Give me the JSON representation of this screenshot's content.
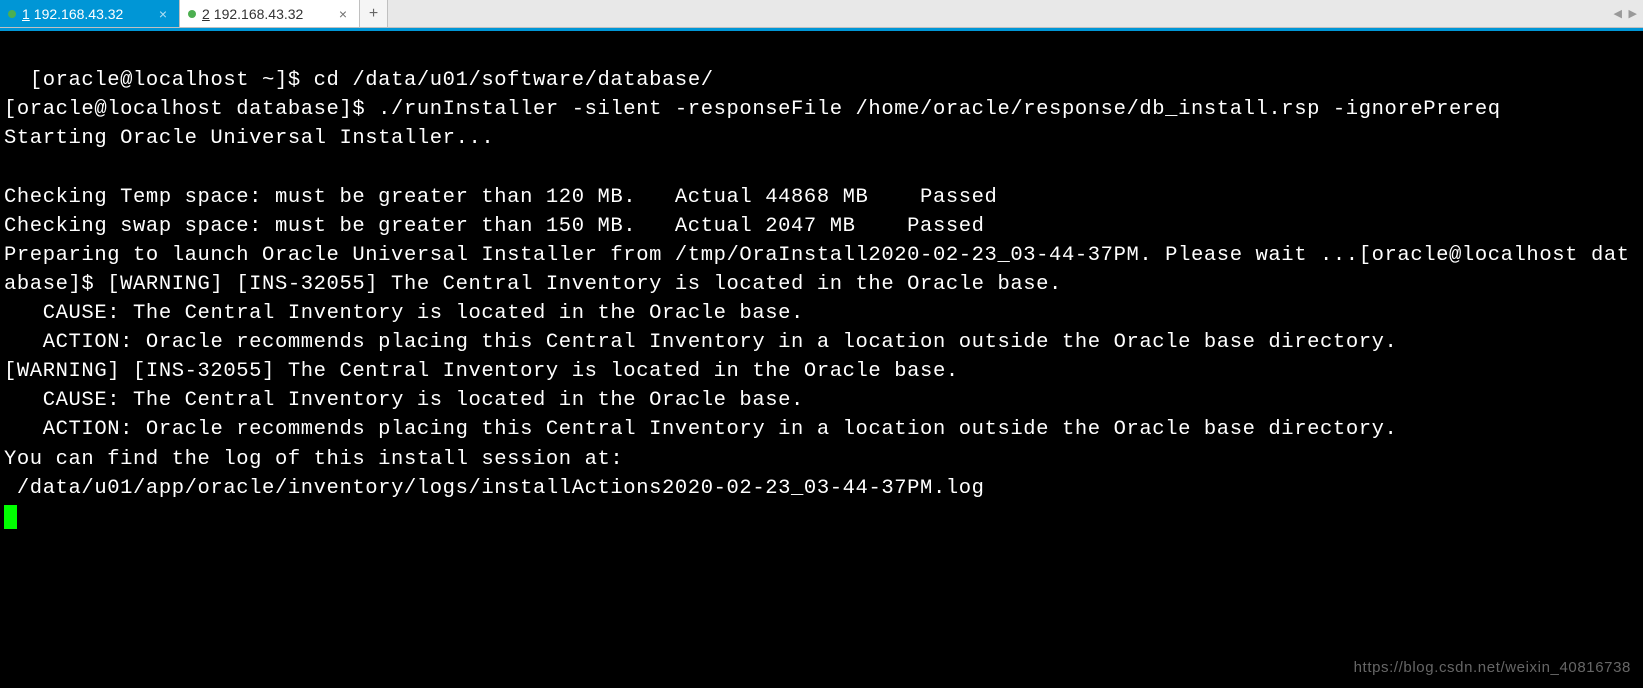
{
  "tabs": [
    {
      "num": "1",
      "label": "192.168.43.32",
      "active": true
    },
    {
      "num": "2",
      "label": "192.168.43.32",
      "active": false
    }
  ],
  "terminal": {
    "lines": "[oracle@localhost ~]$ cd /data/u01/software/database/\n[oracle@localhost database]$ ./runInstaller -silent -responseFile /home/oracle/response/db_install.rsp -ignorePrereq\nStarting Oracle Universal Installer...\n\nChecking Temp space: must be greater than 120 MB.   Actual 44868 MB    Passed\nChecking swap space: must be greater than 150 MB.   Actual 2047 MB    Passed\nPreparing to launch Oracle Universal Installer from /tmp/OraInstall2020-02-23_03-44-37PM. Please wait ...[oracle@localhost database]$ [WARNING] [INS-32055] The Central Inventory is located in the Oracle base.\n   CAUSE: The Central Inventory is located in the Oracle base.\n   ACTION: Oracle recommends placing this Central Inventory in a location outside the Oracle base directory.\n[WARNING] [INS-32055] The Central Inventory is located in the Oracle base.\n   CAUSE: The Central Inventory is located in the Oracle base.\n   ACTION: Oracle recommends placing this Central Inventory in a location outside the Oracle base directory.\nYou can find the log of this install session at:\n /data/u01/app/oracle/inventory/logs/installActions2020-02-23_03-44-37PM.log\n"
  },
  "watermark": "https://blog.csdn.net/weixin_40816738",
  "ui": {
    "close_glyph": "×",
    "add_glyph": "+",
    "nav_glyph": "◀ ▶"
  }
}
